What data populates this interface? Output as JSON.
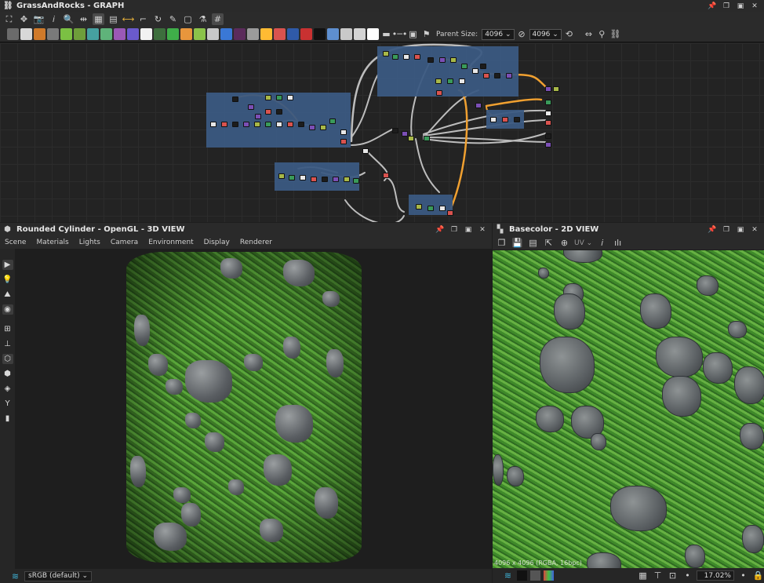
{
  "graph": {
    "title": "GrassAndRocks - GRAPH",
    "toolbar": {
      "parent_size_label": "Parent Size:",
      "parent_size_value": "4096",
      "size_value": "4096"
    },
    "node_tool_colors": [
      "#6b6b6b",
      "#d8d8d8",
      "#d07a2a",
      "#7a7a7a",
      "#7bc043",
      "#6e9e3a",
      "#46a0a0",
      "#5fb37a",
      "#9b59b6",
      "#6a5acd",
      "#f2f2f2",
      "#3d6e3d",
      "#3fae49",
      "#e8963c",
      "#8bc34a",
      "#c8c8c8",
      "#3a78d6",
      "#5b2b5b",
      "#9b9b9b",
      "#ffbb33",
      "#d9534f",
      "#2f5aa8",
      "#c93131",
      "#111111",
      "#5e8fd0",
      "#c9c9c9",
      "#d4d4d4",
      "#ffffff"
    ]
  },
  "view3d": {
    "title": "Rounded Cylinder - OpenGL - 3D VIEW",
    "menu": [
      "Scene",
      "Materials",
      "Lights",
      "Camera",
      "Environment",
      "Display",
      "Renderer"
    ],
    "colorspace": "sRGB (default)"
  },
  "view2d": {
    "title": "Basecolor - 2D VIEW",
    "uv_label": "UV",
    "resolution": "4096 x 4096 (RGBA, 16bpc)",
    "zoom": "17.02%"
  }
}
